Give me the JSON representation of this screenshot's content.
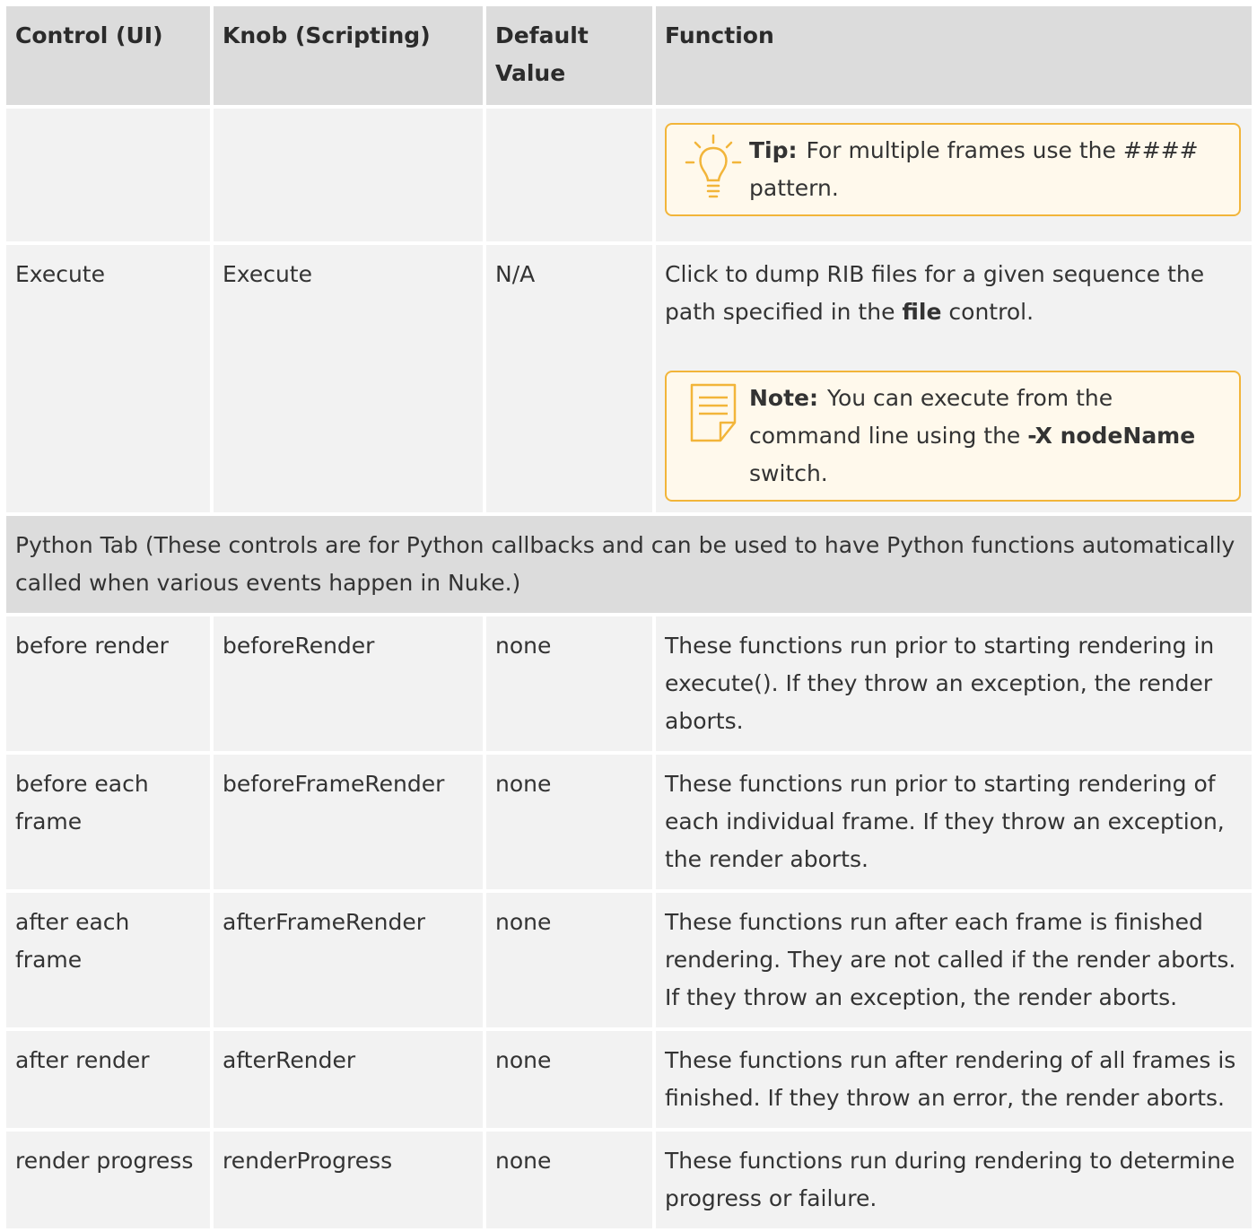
{
  "headers": [
    "Control (UI)",
    "Knob (Scripting)",
    "Default Value",
    "Function"
  ],
  "tip_row": {
    "label": "Tip:",
    "text": "For multiple frames use the #### pattern."
  },
  "execute_row": {
    "control": "Execute",
    "knob": "Execute",
    "default": "N/A",
    "fn_a": "Click to dump RIB files for a given sequence the path specified in the ",
    "fn_bold": "file",
    "fn_b": " control.",
    "note_label": "Note:",
    "note_a": "You can execute from the command line using the ",
    "note_bold": "-X nodeName",
    "note_b": " switch."
  },
  "python_section": "Python Tab (These controls are for Python callbacks and can be used to have Python functions automatically called when various events happen in Nuke.)",
  "rows": [
    {
      "control": "before render",
      "knob": "beforeRender",
      "default": "none",
      "fn": "These functions run prior to starting rendering in execute(). If they throw an exception, the render aborts."
    },
    {
      "control": "before each frame",
      "knob": "beforeFrameRender",
      "default": "none",
      "fn": "These functions run prior to starting rendering of each individual frame. If they throw an exception, the render aborts."
    },
    {
      "control": "after each frame",
      "knob": "afterFrameRender",
      "default": "none",
      "fn": "These functions run after each frame is finished rendering. They are not called if the render aborts. If they throw an exception, the render aborts."
    },
    {
      "control": "after render",
      "knob": "afterRender",
      "default": "none",
      "fn": "These functions run after rendering of all frames is finished. If they throw an error, the render aborts."
    },
    {
      "control": "render progress",
      "knob": "renderProgress",
      "default": "none",
      "fn": "These functions run during rendering to determine progress or failure."
    }
  ],
  "icons": {
    "tip": "lightbulb-icon",
    "note": "note-icon"
  },
  "colors": {
    "header_bg": "#dcdcdc",
    "cell_bg": "#f2f2f2",
    "callout_border": "#f2b53a"
  }
}
